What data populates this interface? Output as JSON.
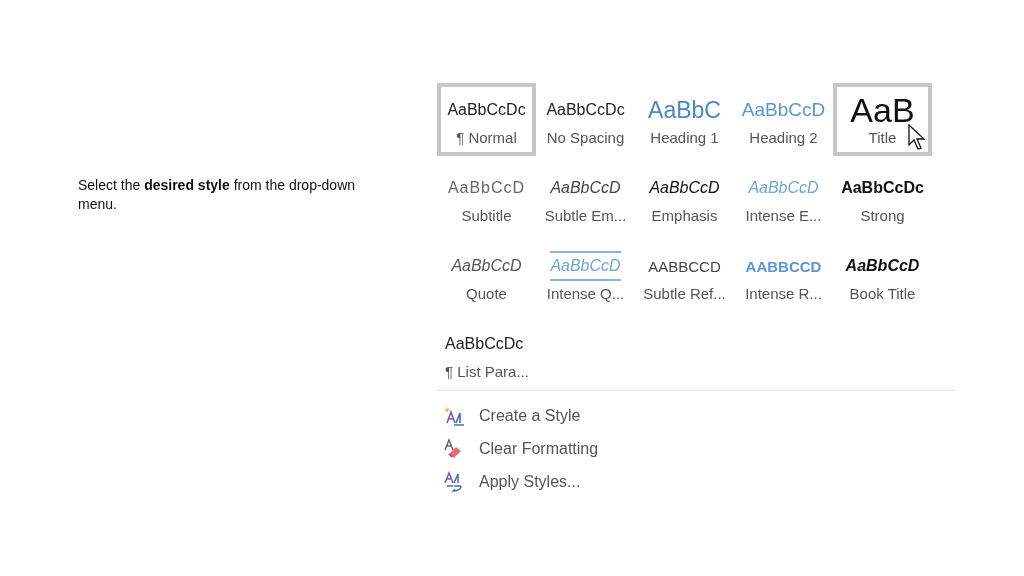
{
  "instruction": "Select the **desired style** from the drop-down menu.",
  "styles": [
    {
      "preview": "AaBbCcDc",
      "name": "¶ Normal",
      "kind": "normal",
      "selected": true,
      "hovered": false
    },
    {
      "preview": "AaBbCcDc",
      "name": "No Spacing",
      "kind": "normal",
      "selected": false,
      "hovered": false
    },
    {
      "preview": "AaBbC",
      "name": "Heading 1",
      "kind": "heading1",
      "selected": false,
      "hovered": false
    },
    {
      "preview": "AaBbCcD",
      "name": "Heading 2",
      "kind": "heading2",
      "selected": false,
      "hovered": false
    },
    {
      "preview": "AaB",
      "name": "Title",
      "kind": "title",
      "selected": true,
      "hovered": true
    },
    {
      "preview": "AaBbCcD",
      "name": "Subtitle",
      "kind": "subtitle",
      "selected": false,
      "hovered": false
    },
    {
      "preview": "AaBbCcD",
      "name": "Subtle Em...",
      "kind": "subtle-emphasis",
      "selected": false,
      "hovered": false
    },
    {
      "preview": "AaBbCcD",
      "name": "Emphasis",
      "kind": "emphasis",
      "selected": false,
      "hovered": false
    },
    {
      "preview": "AaBbCcD",
      "name": "Intense E...",
      "kind": "intense-emphasis",
      "selected": false,
      "hovered": false
    },
    {
      "preview": "AaBbCcDc",
      "name": "Strong",
      "kind": "strong",
      "selected": false,
      "hovered": false
    },
    {
      "preview": "AaBbCcD",
      "name": "Quote",
      "kind": "quote",
      "selected": false,
      "hovered": false
    },
    {
      "preview": "AaBbCcD",
      "name": "Intense Q...",
      "kind": "intense-quote",
      "selected": false,
      "hovered": false
    },
    {
      "preview": "AABBCCD",
      "name": "Subtle Ref...",
      "kind": "subtle-reference",
      "selected": false,
      "hovered": false
    },
    {
      "preview": "AABBCCD",
      "name": "Intense R...",
      "kind": "intense-reference",
      "selected": false,
      "hovered": false
    },
    {
      "preview": "AaBbCcD",
      "name": "Book Title",
      "kind": "book-title",
      "selected": false,
      "hovered": false
    },
    {
      "preview": "AaBbCcDc",
      "name": "¶ List Para...",
      "kind": "list",
      "selected": false,
      "hovered": false
    }
  ],
  "menu": [
    {
      "label": "Create a Style",
      "kind": "create"
    },
    {
      "label": "Clear Formatting",
      "kind": "clear"
    },
    {
      "label": "Apply Styles...",
      "kind": "apply"
    }
  ]
}
